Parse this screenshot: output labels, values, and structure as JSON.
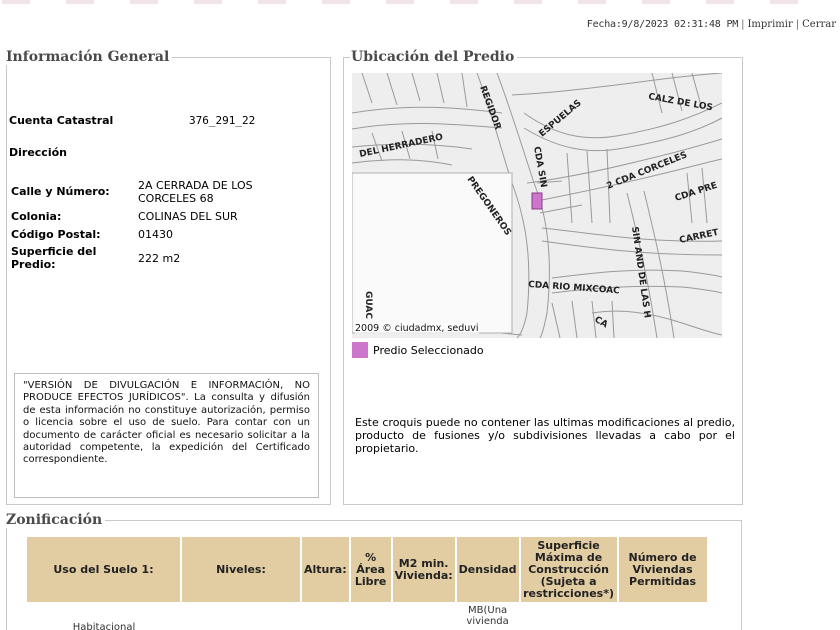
{
  "header": {
    "fecha": "Fecha:9/8/2023 02:31:48 PM",
    "links": [
      "Imprimir",
      "Cerrar"
    ]
  },
  "info": {
    "legend": "Información General",
    "cuenta_label": "Cuenta Catastral",
    "cuenta_value": "376_291_22",
    "direccion_label": "Dirección",
    "calle_label": "Calle y Número:",
    "calle_value": "2A CERRADA DE LOS CORCELES 68",
    "colonia_label": "Colonia:",
    "colonia_value": "COLINAS DEL SUR",
    "cp_label": "Código Postal:",
    "cp_value": "01430",
    "sup_label": "Superficie del Predio:",
    "sup_value": "222 m2",
    "notice": "\"VERSIÓN DE DIVULGACIÓN E INFORMACIÓN, NO PRODUCE EFECTOS JURÍDICOS\". La consulta y difusión de esta información no constituye autorización, permiso o licencia sobre el uso de suelo. Para contar con un documento de carácter oficial es necesario solicitar a la autoridad competente, la expedición del Certificado correspondiente."
  },
  "ubicacion": {
    "legend": "Ubicación del Predio",
    "map_labels": {
      "del_herradero": "DEL HERRADERO",
      "regidor": "REGIDOR",
      "espuelas": "ESPUELAS",
      "calz_de_los": "CALZ DE LOS",
      "cda_sin": "CDA SIN",
      "corceles": "2 CDA CORCELES",
      "pregoneros": "PREGONEROS",
      "cda_pre": "CDA PRE",
      "carret": "CARRET",
      "sin_and": "SIN AND DE LAS H",
      "cda_rio": "CDA RIO MIXCOAC",
      "guac": "GUAC",
      "ca": "CA"
    },
    "credit": "2009 © ciudadmx, seduvi",
    "legend_label": "Predio Seleccionado",
    "highlight_color": "#cc77cc",
    "disclaimer": "Este croquis puede no contener las ultimas modificaciones al predio, producto de fusiones y/o subdivisiones llevadas a cabo por el propietario."
  },
  "zonificacion": {
    "legend": "Zonificación",
    "headers": {
      "uso": "Uso del Suelo 1:",
      "niveles": "Niveles:",
      "altura": "Altura:",
      "area_libre": "% Área Libre",
      "m2_min": "M2 min. Vivienda:",
      "densidad": "Densidad",
      "superficie": "Superficie Máxima de Construcción (Sujeta a restricciones*)",
      "num_viviendas": "Número de Viviendas Permitidas"
    },
    "row": {
      "uso": "Habitacional",
      "densidad": "MB(Una vivienda"
    }
  }
}
